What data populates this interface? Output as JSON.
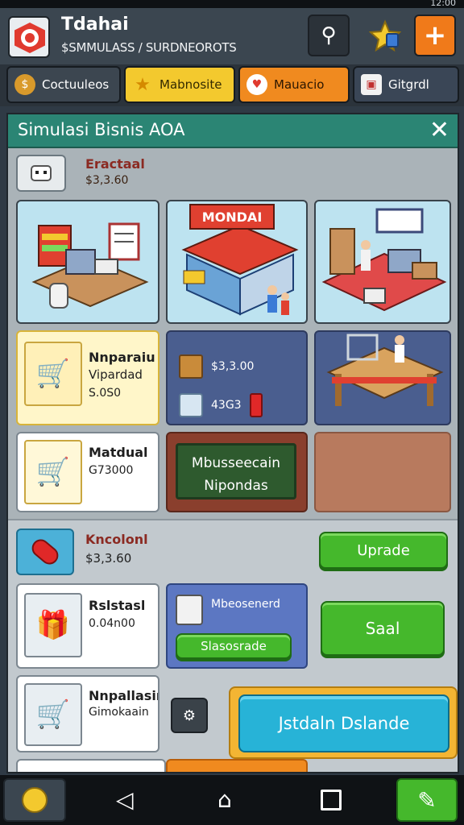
{
  "status": {
    "time": "12:00"
  },
  "header": {
    "title": "Tdahai",
    "subtitle": "$SMMULASS / SURDNEOROTS"
  },
  "tabs": [
    {
      "label": "Coctuuleos",
      "icon": "coin-icon"
    },
    {
      "label": "Mabnosite",
      "icon": "star-icon"
    },
    {
      "label": "Mauacio",
      "icon": "heart-icon"
    },
    {
      "label": "Gitgrdl",
      "icon": "gift-icon"
    }
  ],
  "panel": {
    "title": "Simulasi Bisnis AOA"
  },
  "section1": {
    "name": "Eractaal",
    "price": "$3,3.60",
    "tiles": {
      "market_sign": "MONDAI",
      "cart_tile": {
        "name": "Nnparaiu",
        "sub": "Vipardad",
        "price": "S.0S0"
      },
      "stats": {
        "value1": "$3,3.00",
        "value2": "43G3"
      },
      "manual_tile": {
        "name": "Matdual",
        "price": "G73000"
      },
      "chalkboard": {
        "line1": "Mbusseecain",
        "line2": "Nipondas"
      }
    }
  },
  "section2": {
    "name": "Kncolonl",
    "price": "$3,3.60",
    "upgrade_label": "Uprade",
    "item1": {
      "name": "Rslstasl",
      "price": "0.04n00"
    },
    "blue_tile": {
      "text": "Mbeosenerd",
      "button": "Slasosrade"
    },
    "save_label": "Saal",
    "item2": {
      "name": "Nnpallasin",
      "sub": "Gimokaain"
    },
    "big_button": "Jstdaln Dslande"
  },
  "colors": {
    "accent_green": "#45b82c",
    "accent_orange": "#f08a1f",
    "header_teal": "#2b8574",
    "cyan_button": "#27b3d7"
  }
}
